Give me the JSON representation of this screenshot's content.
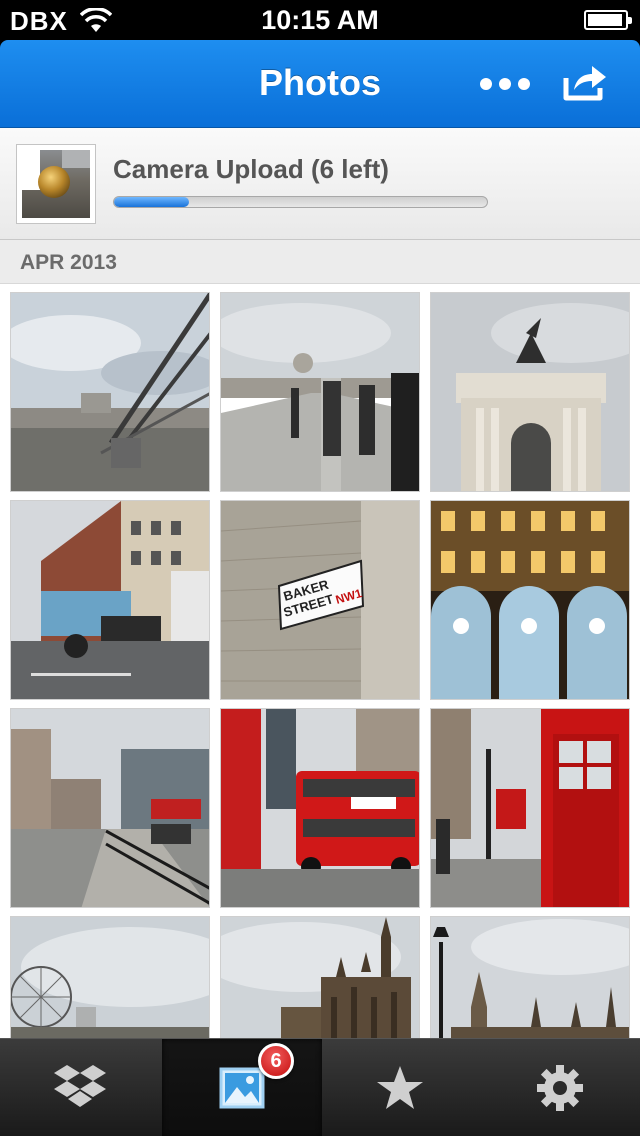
{
  "status_bar": {
    "carrier": "DBX",
    "time": "10:15 AM"
  },
  "nav": {
    "title": "Photos"
  },
  "upload": {
    "title": "Camera Upload (6 left)",
    "progress": 0.2
  },
  "section": {
    "label": "APR 2013"
  },
  "photos": [
    {
      "subject": "millennium-bridge-river"
    },
    {
      "subject": "millennium-bridge-pedestrians"
    },
    {
      "subject": "wellington-arch"
    },
    {
      "subject": "city-street-bus"
    },
    {
      "subject": "baker-street-sign"
    },
    {
      "subject": "apple-store-night"
    },
    {
      "subject": "street-with-railings"
    },
    {
      "subject": "red-double-decker-bus"
    },
    {
      "subject": "red-phone-box"
    },
    {
      "subject": "london-eye"
    },
    {
      "subject": "parliament-towers"
    },
    {
      "subject": "parliament-lamppost"
    }
  ],
  "tabs": [
    {
      "name": "dropbox",
      "icon": "dropbox-icon"
    },
    {
      "name": "photos",
      "icon": "photos-icon",
      "badge": "6",
      "selected": true
    },
    {
      "name": "favorites",
      "icon": "star-icon"
    },
    {
      "name": "settings",
      "icon": "gear-icon"
    }
  ],
  "colors": {
    "nav_blue": "#0a6fd8",
    "badge_red": "#d01010",
    "tab_bar": "#2a2a2a"
  }
}
